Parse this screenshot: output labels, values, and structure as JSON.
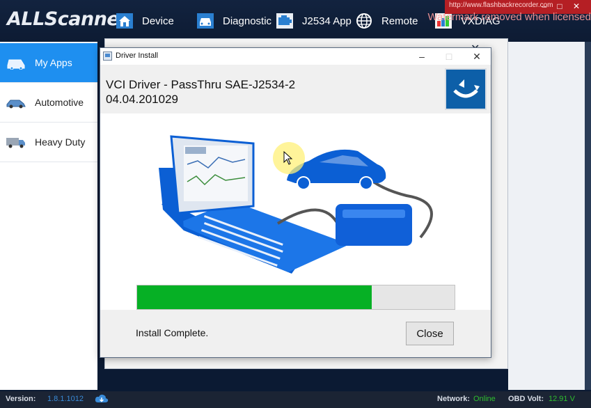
{
  "app": {
    "logo": "ALLScanner",
    "nav": [
      {
        "label": "Device",
        "icon": "home-icon"
      },
      {
        "label": "Diagnostic",
        "icon": "car-front-icon"
      },
      {
        "label": "J2534 App",
        "icon": "engine-icon"
      },
      {
        "label": "Remote",
        "icon": "globe-icon"
      },
      {
        "label": "VXDIAG",
        "icon": "vxdiag-icon"
      }
    ],
    "watermark_url": "http://www.flashbackrecorder.com",
    "watermark_text": "Watermark removed when licensed"
  },
  "sidebar": {
    "items": [
      {
        "label": "My Apps",
        "icon": "car-icon",
        "active": true
      },
      {
        "label": "Automotive",
        "icon": "sedan-icon",
        "active": false
      },
      {
        "label": "Heavy Duty",
        "icon": "truck-icon",
        "active": false
      }
    ]
  },
  "status": {
    "version_label": "Version:",
    "version_value": "1.8.1.1012",
    "network_label": "Network:",
    "network_value": "Online",
    "obd_label": "OBD Volt:",
    "obd_value": "12.91 V"
  },
  "dialog": {
    "window_title": "Driver Install",
    "heading_line1": "VCI Driver - PassThru SAE-J2534-2",
    "heading_line2": "04.04.201029",
    "progress": 0.74,
    "status_text": "Install Complete.",
    "close_label": "Close"
  },
  "colors": {
    "accent": "#1e8ff0",
    "progress": "#06b025",
    "topbar": "#12233f",
    "online": "#2fbf2f"
  }
}
